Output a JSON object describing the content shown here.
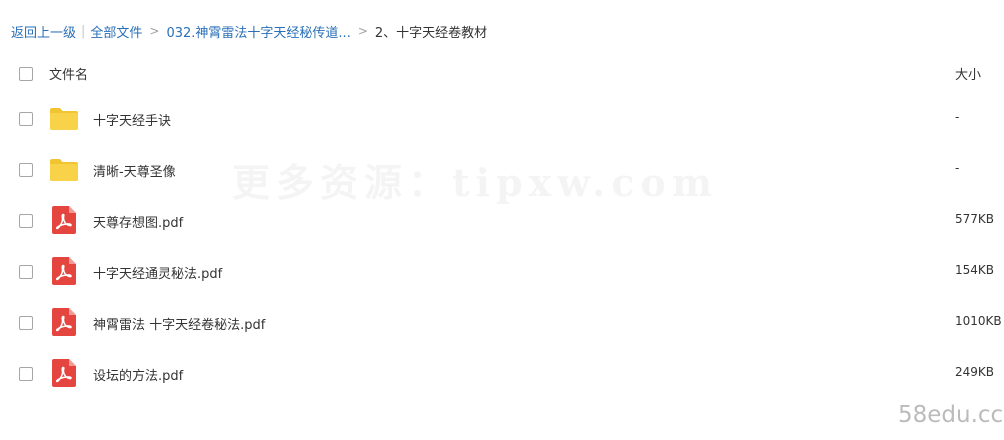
{
  "breadcrumb": {
    "back": "返回上一级",
    "separator": "|",
    "all_files": "全部文件",
    "arrow": ">",
    "parent": "032.神霄雷法十字天经秘传道...",
    "current": "2、十字天经卷教材"
  },
  "table": {
    "header_name": "文件名",
    "header_size": "大小"
  },
  "files": [
    {
      "name": "十字天经手诀",
      "size": "-",
      "icon": "folder-icon"
    },
    {
      "name": "清晰-天尊圣像",
      "size": "-",
      "icon": "folder-icon"
    },
    {
      "name": "天尊存想图.pdf",
      "size": "577KB",
      "icon": "pdf-icon"
    },
    {
      "name": "十字天经通灵秘法.pdf",
      "size": "154KB",
      "icon": "pdf-icon"
    },
    {
      "name": "神霄雷法 十字天经卷秘法.pdf",
      "size": "1010KB",
      "icon": "pdf-icon"
    },
    {
      "name": "设坛的方法.pdf",
      "size": "249KB",
      "icon": "pdf-icon"
    }
  ],
  "watermarks": {
    "center": "更多资源：tipxw.com",
    "corner": "58edu.cc"
  },
  "colors": {
    "link": "#2a6fb8",
    "folder": "#f8d34a",
    "pdf": "#e5453f"
  }
}
